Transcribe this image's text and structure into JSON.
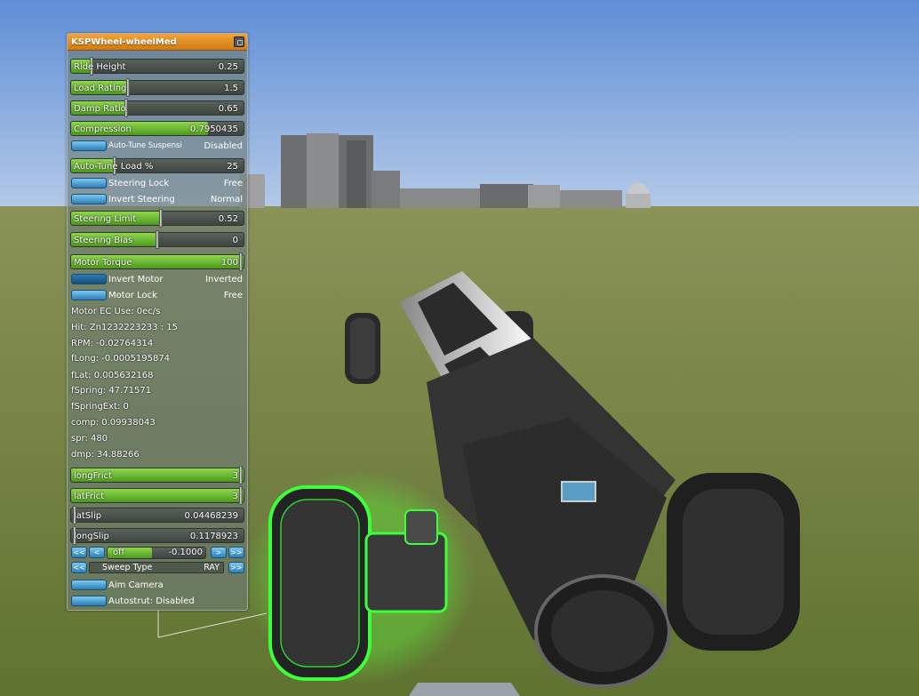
{
  "panel": {
    "title": "KSPWheel-wheelMed",
    "sliders": [
      {
        "label": "Ride Height",
        "value": "0.25",
        "fraction": 0.12
      },
      {
        "label": "Load Rating",
        "value": "1.5",
        "fraction": 0.33
      },
      {
        "label": "Damp Ratio",
        "value": "0.65",
        "fraction": 0.32
      }
    ],
    "compression": {
      "label": "Compression",
      "value": "0.7950435",
      "fraction": 0.795
    },
    "autotune_susp": {
      "label": "Auto-Tune Suspensi",
      "value": "Disabled"
    },
    "autotune_load": {
      "label": "Auto-Tune Load %",
      "value": "25",
      "fraction": 0.25
    },
    "steering_lock": {
      "label": "Steering Lock",
      "value": "Free"
    },
    "invert_steering": {
      "label": "Invert Steering",
      "value": "Normal"
    },
    "steering_limit": {
      "label": "Steering Limit",
      "value": "0.52",
      "fraction": 0.52
    },
    "steering_bias": {
      "label": "Steering Bias",
      "value": "0",
      "fraction": 0.5
    },
    "motor_torque": {
      "label": "Motor Torque",
      "value": "100",
      "fraction": 1.0
    },
    "invert_motor": {
      "label": "Invert Motor",
      "value": "Inverted"
    },
    "motor_lock": {
      "label": "Motor Lock",
      "value": "Free"
    },
    "info": [
      "Motor EC Use: 0ec/s",
      "Hit: Zn1232223233 : 15",
      "RPM: -0.02764314",
      "fLong: -0.0005195874",
      "fLat: 0.005632168",
      "fSpring: 47.71571",
      "fSpringExt: 0",
      "comp: 0.09938043",
      "spr: 480",
      "dmp: 34.88266"
    ],
    "long_frict": {
      "label": "longFrict",
      "value": "3",
      "fraction": 1.0
    },
    "lat_frict": {
      "label": "latFrict",
      "value": "3",
      "fraction": 1.0
    },
    "lat_slip": {
      "label": "latSlip",
      "value": "0.04468239"
    },
    "long_slip": {
      "label": "longSlip",
      "value": "0.1178923"
    },
    "offset": {
      "btn_prev2": "<<",
      "btn_prev": "<",
      "label": "off",
      "value": "-0.1000",
      "btn_next": ">",
      "btn_next2": ">>",
      "fraction": 0.45
    },
    "sweep": {
      "btn_prev2": "<<",
      "label": "Sweep Type",
      "value": "RAY",
      "btn_next2": ">>"
    },
    "aim_camera": {
      "label": "Aim Camera"
    },
    "autostrut": {
      "label": "Autostrut: Disabled"
    }
  },
  "colors": {
    "title_bar": "#e8901f",
    "slider_fill": "#6dbb35",
    "button": "#4aa3d8",
    "highlight": "#3cff3c"
  }
}
